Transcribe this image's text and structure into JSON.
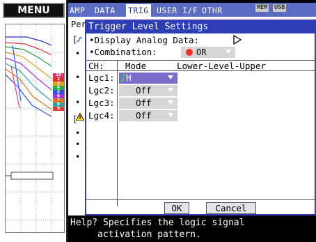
{
  "menu": {
    "label": "MENU"
  },
  "minichart": {
    "channel_tags": [
      {
        "text": "10",
        "color": "#e0306a"
      },
      {
        "text": "2",
        "color": "#e03030"
      },
      {
        "text": "3",
        "color": "#e0a020"
      },
      {
        "text": "4",
        "color": "#20b040"
      },
      {
        "text": "5",
        "color": "#3050e0"
      },
      {
        "text": "6",
        "color": "#a030e0"
      },
      {
        "text": "7",
        "color": "#e07020"
      },
      {
        "text": "8",
        "color": "#30a0a0"
      },
      {
        "text": "9",
        "color": "#e04040"
      }
    ]
  },
  "tabs": [
    {
      "label": "AMP",
      "active": false
    },
    {
      "label": "DATA",
      "active": false
    },
    {
      "label": "TRIG",
      "active": true
    },
    {
      "label": "USER I/F",
      "active": false
    },
    {
      "label": "OTHR",
      "active": false
    }
  ],
  "status": {
    "mem": "MEM",
    "usb": "USB"
  },
  "background_page": {
    "line1": "Per",
    "line2": "[",
    "line3": "•",
    "line4": "•",
    "line5": "•",
    "line6": "[",
    "line7": "•",
    "line8": "•",
    "line9": "•"
  },
  "dialog": {
    "title": "Trigger Level Settings",
    "display_analog_label": "•Display Analog Data:",
    "combination_label": "•Combination:",
    "combination_value": "OR",
    "header": {
      "ch": "CH:",
      "mode": "Mode",
      "levels": "Lower-Level-Upper"
    },
    "rows": [
      {
        "label": "Lgc1:",
        "value": "H",
        "selected": true
      },
      {
        "label": "Lgc2:",
        "value": "Off",
        "selected": false
      },
      {
        "label": "Lgc3:",
        "value": "Off",
        "selected": false
      },
      {
        "label": "Lgc4:",
        "value": "Off",
        "selected": false
      }
    ],
    "ok_label": "OK",
    "cancel_label": "Cancel"
  },
  "help": {
    "line1": "Help? Specifies the logic signal",
    "line2": "     activation pattern."
  },
  "colors": {
    "title_bar": "#2d3db4",
    "tab_bar": "#5c6cc4",
    "selected_row": "#7b6cc9",
    "combo_bg": "#d6d6d6"
  }
}
